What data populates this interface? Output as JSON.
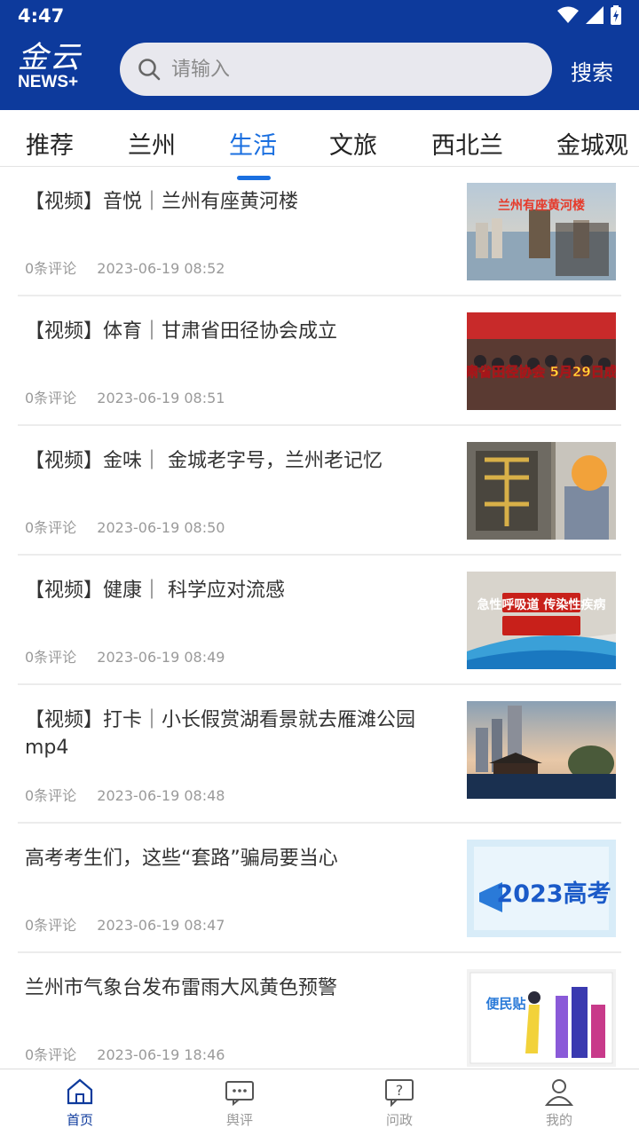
{
  "status": {
    "time": "4:47"
  },
  "logo": {
    "cn": "金云",
    "en": "NEWS+"
  },
  "search": {
    "placeholder": "请输入",
    "button": "搜索"
  },
  "tabs": [
    {
      "label": "推荐"
    },
    {
      "label": "兰州"
    },
    {
      "label": "生活"
    },
    {
      "label": "文旅"
    },
    {
      "label": "西北兰"
    },
    {
      "label": "金城观"
    }
  ],
  "active_tab": "生活",
  "articles": [
    {
      "title": "【视频】音悦｜兰州有座黄河楼",
      "comments": "0条评论",
      "time": "2023-06-19 08:52",
      "thumb_text": "兰州有座黄河楼"
    },
    {
      "title": "【视频】体育｜甘肃省田径协会成立",
      "comments": "0条评论",
      "time": "2023-06-19 08:51",
      "thumb_text": "甘肃省田径协会 5月29日成立"
    },
    {
      "title": "【视频】金味｜ 金城老字号，兰州老记忆",
      "comments": "0条评论",
      "time": "2023-06-19 08:50",
      "thumb_text": ""
    },
    {
      "title": "【视频】健康｜ 科学应对流感",
      "comments": "0条评论",
      "time": "2023-06-19 08:49",
      "thumb_text": "急性呼吸道 传染性疾病"
    },
    {
      "title": "【视频】打卡｜小长假赏湖看景就去雁滩公园mp4",
      "comments": "0条评论",
      "time": "2023-06-19 08:48",
      "thumb_text": ""
    },
    {
      "title": "高考考生们，这些“套路”骗局要当心",
      "comments": "0条评论",
      "time": "2023-06-19 08:47",
      "thumb_text": "2023高考"
    },
    {
      "title": "兰州市气象台发布雷雨大风黄色预警",
      "comments": "0条评论",
      "time": "2023-06-19 18:46",
      "thumb_text": "便民贴"
    }
  ],
  "bottom_nav": [
    {
      "label": "首页",
      "icon": "home-icon"
    },
    {
      "label": "舆评",
      "icon": "chat-icon"
    },
    {
      "label": "问政",
      "icon": "question-icon"
    },
    {
      "label": "我的",
      "icon": "user-icon"
    }
  ],
  "colors": {
    "brand": "#0d3a9c",
    "accent": "#1a6fe0"
  }
}
